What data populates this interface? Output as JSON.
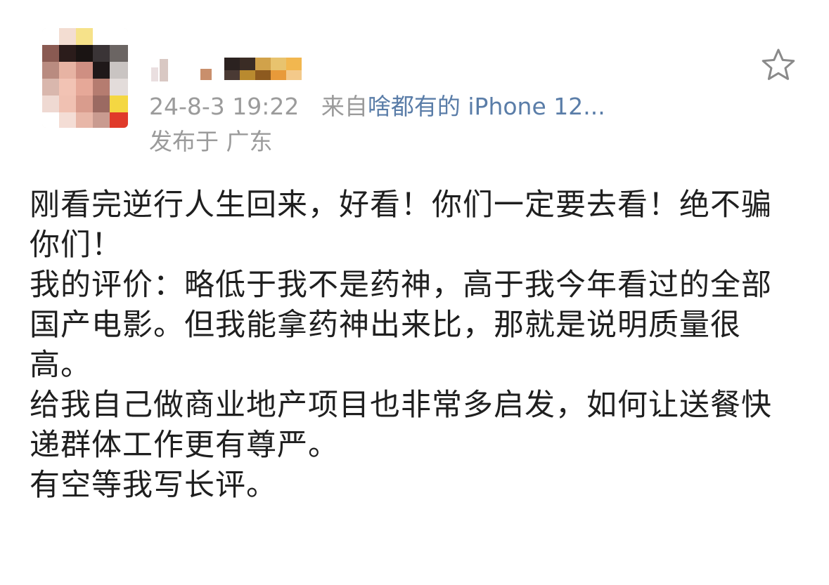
{
  "post": {
    "timestamp": "24-8-3 19:22",
    "source_prefix": "来自",
    "source_device": "啥都有的 iPhone 12...",
    "location": "发布于 广东",
    "paragraphs": [
      "刚看完逆行人生回来，好看！你们一定要去看！绝不骗你们！",
      "我的评价：略低于我不是药神，高于我今年看过的全部国产电影。但我能拿药神出来比，那就是说明质量很高。",
      "给我自己做商业地产项目也非常多启发，如何让送餐快递群体工作更有尊严。",
      "有空等我写长评。"
    ]
  },
  "colors": {
    "meta_gray": "#9b9b9b",
    "link_blue": "#5a7da8",
    "body_text": "#1f1f1f",
    "star_outline": "#8a8a8a"
  },
  "icons": {
    "favorite": "star-outline-icon"
  }
}
